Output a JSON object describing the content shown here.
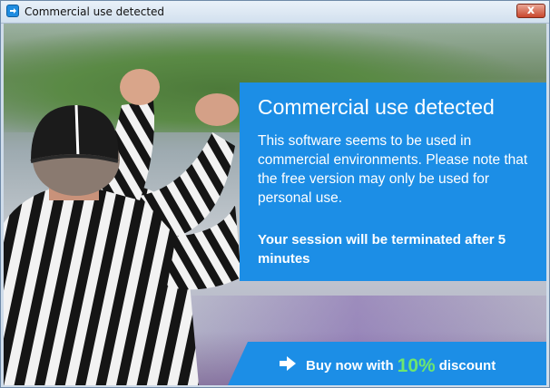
{
  "window": {
    "title": "Commercial use detected",
    "close_label": "x"
  },
  "panel": {
    "title": "Commercial use detected",
    "body": "This software seems to be used in commercial environments. Please note that the free version may only be used for personal use.",
    "warning": "Your session will be terminated after 5 minutes"
  },
  "buy": {
    "prefix": "Buy now with",
    "discount": "10%",
    "suffix": "discount"
  },
  "icons": {
    "app": "teamviewer-app-icon",
    "close": "close-icon",
    "arrow": "arrow-right-icon",
    "photo": "referee-photo"
  },
  "colors": {
    "accent": "#1c8ee6",
    "discount_green": "#6ee66e"
  }
}
